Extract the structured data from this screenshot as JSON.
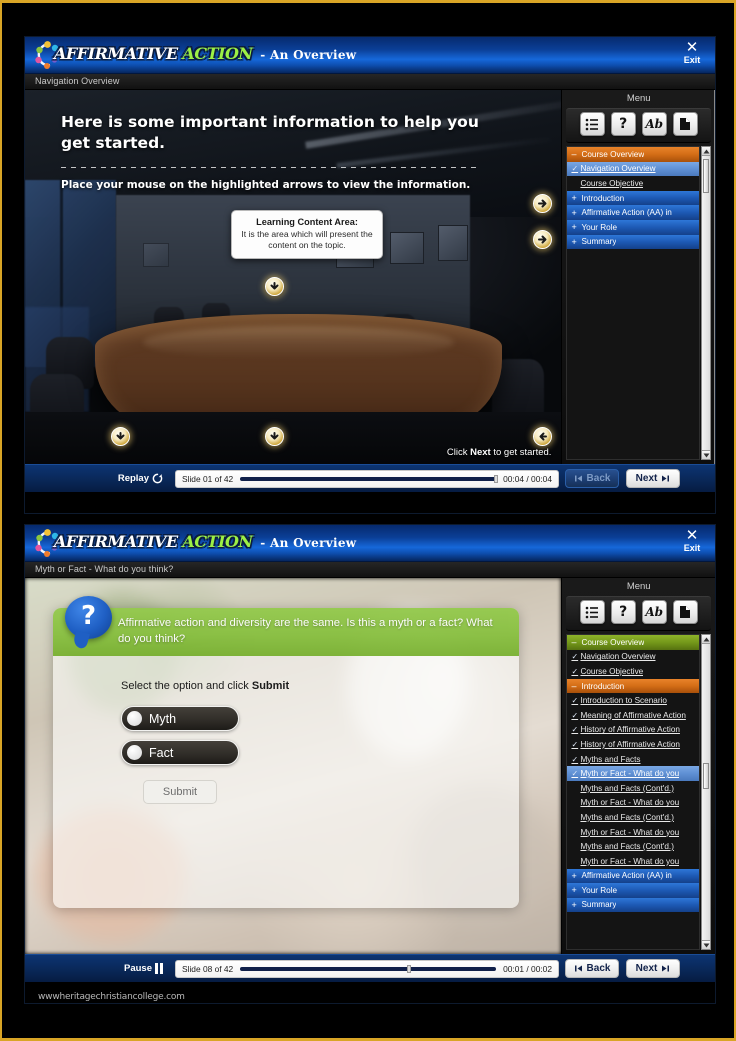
{
  "brand": {
    "word_one": "AFFIRMATIVE",
    "word_two": "ACTION",
    "subtitle": "- An Overview",
    "logo_icon": "molecule-logo-icon"
  },
  "exit": {
    "icon": "close-icon",
    "glyph": "✕",
    "label": "Exit"
  },
  "colors": {
    "header_blue": "#1668da",
    "accent_green": "#8cc63f",
    "accent_orange": "#d36d16",
    "selected_blue": "#5f90d4",
    "hotspot_gold": "#c99f2e",
    "page_border": "#d9a526"
  },
  "menu": {
    "title": "Menu",
    "tools": [
      {
        "name": "outline-list-icon",
        "glyph": "list"
      },
      {
        "name": "help-question-icon",
        "glyph": "?"
      },
      {
        "name": "glossary-ab-icon",
        "glyph": "Ab"
      },
      {
        "name": "resources-page-icon",
        "glyph": "page"
      }
    ]
  },
  "screen_one": {
    "breadcrumb": "Navigation Overview",
    "heading": "Here is some important information to help you get started.",
    "instruction": "Place your mouse on the highlighted arrows to view the information.",
    "callout": {
      "title": "Learning Content Area:",
      "body": "It is the area which will present the content on the topic."
    },
    "stage_hint_pre": "Click ",
    "stage_hint_bold": "Next",
    "stage_hint_post": " to get started.",
    "hotspots": [
      {
        "name": "hotspot-right-top",
        "direction": "right"
      },
      {
        "name": "hotspot-right-mid",
        "direction": "right"
      },
      {
        "name": "hotspot-content-area",
        "direction": "down"
      },
      {
        "name": "hotspot-bottom-left",
        "direction": "down"
      },
      {
        "name": "hotspot-bottom-center",
        "direction": "down"
      },
      {
        "name": "hotspot-bottom-right",
        "direction": "left"
      }
    ],
    "menu_items": [
      {
        "label": "Course Overview",
        "type": "group",
        "state": "orange",
        "toggle": "–"
      },
      {
        "label": "Navigation Overview",
        "type": "leaf",
        "state": "selected",
        "tick": "✓"
      },
      {
        "label": "Course Objective",
        "type": "leaf",
        "state": "normal",
        "tick": ""
      },
      {
        "label": "Introduction",
        "type": "group",
        "state": "blue",
        "toggle": "+"
      },
      {
        "label": "Affirmative Action (AA) in",
        "type": "group",
        "state": "blue",
        "toggle": "+"
      },
      {
        "label": "Your Role",
        "type": "group",
        "state": "blue",
        "toggle": "+"
      },
      {
        "label": "Summary",
        "type": "group",
        "state": "blue",
        "toggle": "+"
      }
    ],
    "controls": {
      "play_label": "Replay",
      "play_icon": "replay-icon",
      "slide_label": "Slide 01 of 42",
      "time": "00:04 / 00:04",
      "progress_percent": 100,
      "back_label": "Back",
      "back_enabled": false,
      "next_label": "Next",
      "next_enabled": true
    }
  },
  "screen_two": {
    "breadcrumb": "Myth or Fact - What do you think?",
    "question": "Affirmative action and diversity are the same. Is this a myth or a fact? What do you think?",
    "question_icon": "question-bubble-icon",
    "prompt_pre": "Select the option and click ",
    "prompt_bold": "Submit",
    "options": [
      {
        "label": "Myth",
        "selected": false
      },
      {
        "label": "Fact",
        "selected": false
      }
    ],
    "submit_label": "Submit",
    "menu_items": [
      {
        "label": "Course Overview",
        "type": "group",
        "state": "green",
        "toggle": "–"
      },
      {
        "label": "Navigation Overview",
        "type": "leaf",
        "state": "done",
        "tick": "✓"
      },
      {
        "label": "Course Objective",
        "type": "leaf",
        "state": "done",
        "tick": "✓"
      },
      {
        "label": "Introduction",
        "type": "group",
        "state": "orange",
        "toggle": "–"
      },
      {
        "label": "Introduction to Scenario",
        "type": "leaf",
        "state": "done",
        "tick": "✓"
      },
      {
        "label": "Meaning of Affirmative Action",
        "type": "leaf",
        "state": "done",
        "tick": "✓"
      },
      {
        "label": "History of Affirmative Action",
        "type": "leaf",
        "state": "done",
        "tick": "✓"
      },
      {
        "label": "History of Affirmative Action",
        "type": "leaf",
        "state": "done",
        "tick": "✓"
      },
      {
        "label": "Myths and Facts",
        "type": "leaf",
        "state": "done",
        "tick": "✓"
      },
      {
        "label": "Myth or Fact - What do you",
        "type": "leaf",
        "state": "selected",
        "tick": "✓"
      },
      {
        "label": "Myths and Facts (Cont'd.)",
        "type": "leaf",
        "state": "normal",
        "tick": ""
      },
      {
        "label": "Myth or Fact - What do you",
        "type": "leaf",
        "state": "normal",
        "tick": ""
      },
      {
        "label": "Myths and Facts (Cont'd.)",
        "type": "leaf",
        "state": "normal",
        "tick": ""
      },
      {
        "label": "Myth or Fact - What do you",
        "type": "leaf",
        "state": "normal",
        "tick": ""
      },
      {
        "label": "Myths and Facts (Cont'd.)",
        "type": "leaf",
        "state": "normal",
        "tick": ""
      },
      {
        "label": "Myth or Fact - What do you",
        "type": "leaf",
        "state": "normal",
        "tick": ""
      },
      {
        "label": "Affirmative Action (AA) in",
        "type": "group",
        "state": "blue",
        "toggle": "+"
      },
      {
        "label": "Your Role",
        "type": "group",
        "state": "blue",
        "toggle": "+"
      },
      {
        "label": "Summary",
        "type": "group",
        "state": "blue",
        "toggle": "+"
      }
    ],
    "controls": {
      "play_label": "Pause",
      "play_icon": "pause-icon",
      "slide_label": "Slide 08 of 42",
      "time": "00:01 / 00:02",
      "progress_percent": 66,
      "back_label": "Back",
      "back_enabled": true,
      "next_label": "Next",
      "next_enabled": true
    }
  },
  "watermark": "wwwheritagechristiancollege.com"
}
